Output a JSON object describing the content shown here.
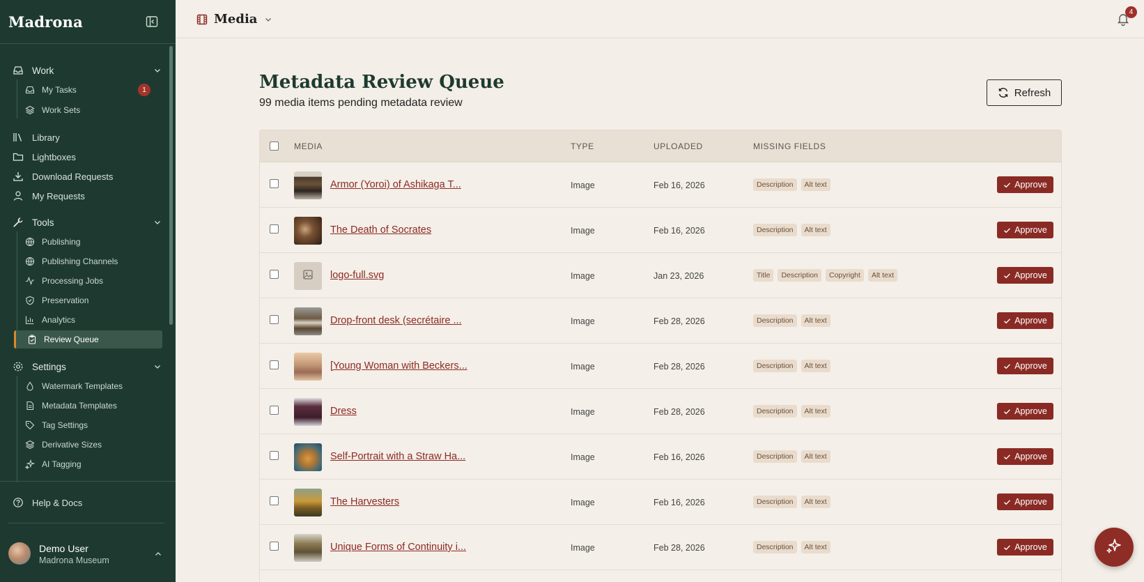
{
  "sidebar": {
    "brand": "Madrona",
    "sections": {
      "work": "Work",
      "tools": "Tools",
      "settings": "Settings"
    },
    "work_items": [
      {
        "label": "My Tasks",
        "icon": "inbox-icon",
        "badge": "1"
      },
      {
        "label": "Work Sets",
        "icon": "layers-icon"
      }
    ],
    "top_items": [
      {
        "label": "Library",
        "icon": "library-icon"
      },
      {
        "label": "Lightboxes",
        "icon": "folder-icon"
      },
      {
        "label": "Download Requests",
        "icon": "download-icon"
      },
      {
        "label": "My Requests",
        "icon": "user-icon"
      }
    ],
    "tools_items": [
      {
        "label": "Publishing",
        "icon": "globe-icon"
      },
      {
        "label": "Publishing Channels",
        "icon": "globe-icon"
      },
      {
        "label": "Processing Jobs",
        "icon": "activity-icon"
      },
      {
        "label": "Preservation",
        "icon": "shield-icon"
      },
      {
        "label": "Analytics",
        "icon": "bar-chart-icon"
      },
      {
        "label": "Review Queue",
        "icon": "clipboard-check-icon"
      }
    ],
    "settings_items": [
      {
        "label": "Watermark Templates",
        "icon": "droplet-icon"
      },
      {
        "label": "Metadata Templates",
        "icon": "file-icon"
      },
      {
        "label": "Tag Settings",
        "icon": "tag-icon"
      },
      {
        "label": "Derivative Sizes",
        "icon": "layers-icon"
      },
      {
        "label": "AI Tagging",
        "icon": "sparkles-icon"
      }
    ],
    "help": "Help & Docs",
    "user": {
      "name": "Demo User",
      "org": "Madrona Museum"
    }
  },
  "topbar": {
    "title": "Media",
    "notifications": "4"
  },
  "main": {
    "title": "Metadata Review Queue",
    "subtitle": "99 media items pending metadata review",
    "refresh_label": "Refresh",
    "columns": {
      "media": "MEDIA",
      "type": "TYPE",
      "uploaded": "UPLOADED",
      "missing": "MISSING FIELDS"
    },
    "approve_label": "Approve",
    "rows": [
      {
        "name": "Armor (Yoroi) of Ashikaga T...",
        "type": "Image",
        "date": "Feb 16, 2026",
        "missing": [
          "Description",
          "Alt text"
        ],
        "thumb": "armor"
      },
      {
        "name": "The Death of Socrates",
        "type": "Image",
        "date": "Feb 16, 2026",
        "missing": [
          "Description",
          "Alt text"
        ],
        "thumb": "socrates"
      },
      {
        "name": "logo-full.svg",
        "type": "Image",
        "date": "Jan 23, 2026",
        "missing": [
          "Title",
          "Description",
          "Copyright",
          "Alt text"
        ],
        "thumb": "placeholder"
      },
      {
        "name": "Drop-front desk (secrétaire ...",
        "type": "Image",
        "date": "Feb 28, 2026",
        "missing": [
          "Description",
          "Alt text"
        ],
        "thumb": "desk"
      },
      {
        "name": "[Young Woman with Beckers...",
        "type": "Image",
        "date": "Feb 28, 2026",
        "missing": [
          "Description",
          "Alt text"
        ],
        "thumb": "woman"
      },
      {
        "name": "Dress",
        "type": "Image",
        "date": "Feb 28, 2026",
        "missing": [
          "Description",
          "Alt text"
        ],
        "thumb": "dress"
      },
      {
        "name": "Self-Portrait with a Straw Ha...",
        "type": "Image",
        "date": "Feb 16, 2026",
        "missing": [
          "Description",
          "Alt text"
        ],
        "thumb": "vangogh"
      },
      {
        "name": "The Harvesters",
        "type": "Image",
        "date": "Feb 16, 2026",
        "missing": [
          "Description",
          "Alt text"
        ],
        "thumb": "harvesters"
      },
      {
        "name": "Unique Forms of Continuity i...",
        "type": "Image",
        "date": "Feb 28, 2026",
        "missing": [
          "Description",
          "Alt text"
        ],
        "thumb": "sculpture"
      }
    ]
  }
}
